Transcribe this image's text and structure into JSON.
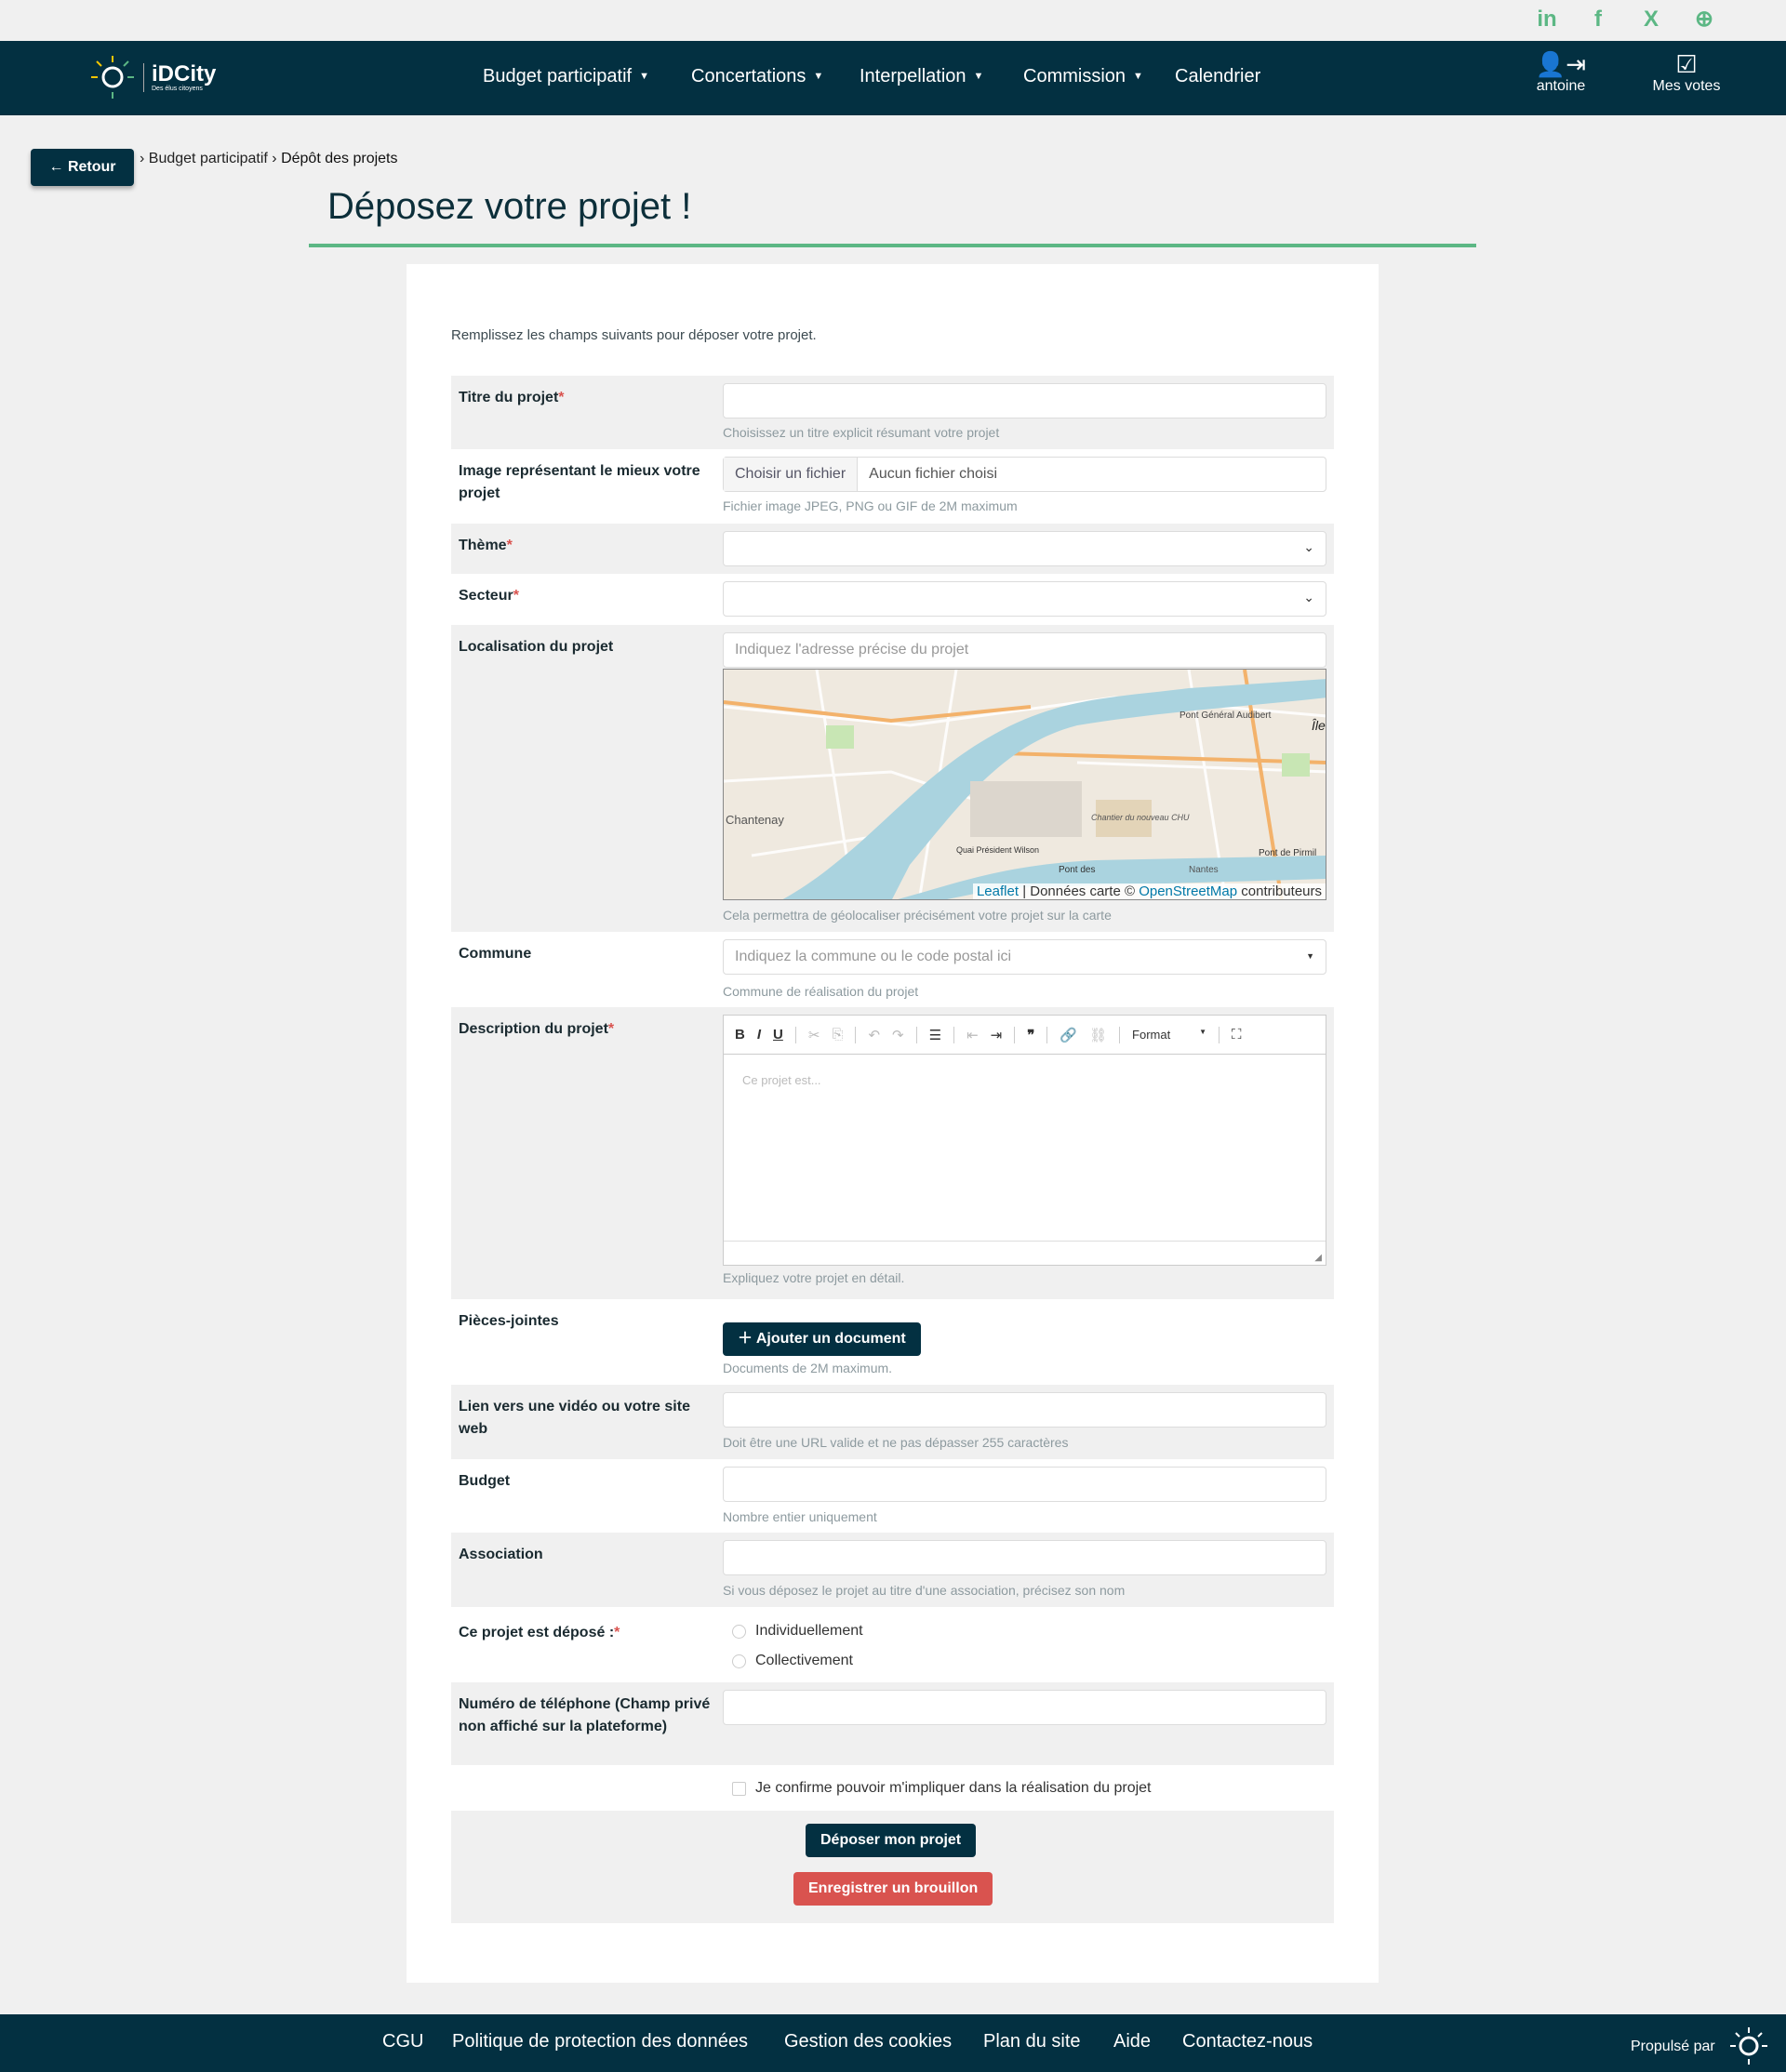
{
  "social": [
    {
      "icon": "linkedin-icon",
      "glyph": "in"
    },
    {
      "icon": "facebook-icon",
      "glyph": "f"
    },
    {
      "icon": "x-icon",
      "glyph": "X"
    },
    {
      "icon": "globe-icon",
      "glyph": "⊕"
    }
  ],
  "header": {
    "logo": "iDCity",
    "logo_sub": "Des élus citoyens",
    "nav": [
      "Budget participatif",
      "Concertations",
      "Interpellation",
      "Commission",
      "Calendrier"
    ],
    "user": "antoine",
    "votes": "Mes votes"
  },
  "back": "Retour",
  "breadcrumb": [
    "Budget participatif",
    "Dépôt des projets"
  ],
  "title": "Déposez votre projet !",
  "intro": "Remplissez les champs suivants pour déposer votre projet.",
  "fields": {
    "titre": {
      "label": "Titre du projet",
      "help": "Choisissez un titre explicit résumant votre projet"
    },
    "image": {
      "label": "Image représentant le mieux votre projet",
      "button": "Choisir un fichier",
      "value": "Aucun fichier choisi",
      "help": "Fichier image JPEG, PNG ou GIF de 2M maximum"
    },
    "theme": {
      "label": "Thème"
    },
    "secteur": {
      "label": "Secteur"
    },
    "localisation": {
      "label": "Localisation du projet",
      "placeholder": "Indiquez l'adresse précise du projet",
      "help": "Cela permettra de géolocaliser précisément votre projet sur la carte"
    },
    "commune": {
      "label": "Commune",
      "placeholder": "Indiquez la commune ou le code postal ici",
      "help": "Commune de réalisation du projet"
    },
    "description": {
      "label": "Description du projet",
      "placeholder": "Ce projet est...",
      "format": "Format",
      "help": "Expliquez votre projet en détail."
    },
    "pieces": {
      "label": "Pièces-jointes",
      "button": "Ajouter un document",
      "help": "Documents de 2M maximum."
    },
    "lien": {
      "label": "Lien vers une vidéo ou votre site web",
      "help": "Doit être une URL valide et ne pas dépasser 255 caractères"
    },
    "budget": {
      "label": "Budget",
      "help": "Nombre entier uniquement"
    },
    "association": {
      "label": "Association",
      "help": "Si vous déposez le projet au titre d'une association, précisez son nom"
    },
    "depose": {
      "label": "Ce projet est déposé :",
      "options": [
        "Individuellement",
        "Collectivement"
      ]
    },
    "telephone": {
      "label": "Numéro de téléphone (Champ privé non affiché sur la plateforme)"
    },
    "confirm": "Je confirme pouvoir m'impliquer dans la réalisation du projet"
  },
  "map": {
    "labels": [
      "Chantenay",
      "Pont Général Audibert",
      "Île",
      "Chantier du nouveau CHU",
      "Quai Président Wilson",
      "Pont des",
      "Nantes",
      "Pont de Pirmil"
    ],
    "attribution": {
      "leaflet": "Leaflet",
      "mid": "| Données carte ©",
      "osm": "OpenStreetMap",
      "end": "contributeurs"
    }
  },
  "actions": {
    "submit": "Déposer mon projet",
    "draft": "Enregistrer un brouillon"
  },
  "footer": {
    "links": [
      "CGU",
      "Politique de protection des données",
      "Gestion des cookies",
      "Plan du site",
      "Aide",
      "Contactez-nous"
    ],
    "powered": "Propulsé par"
  },
  "colors": {
    "navy": "#033041",
    "green": "#5cb784",
    "danger": "#d9534f"
  }
}
